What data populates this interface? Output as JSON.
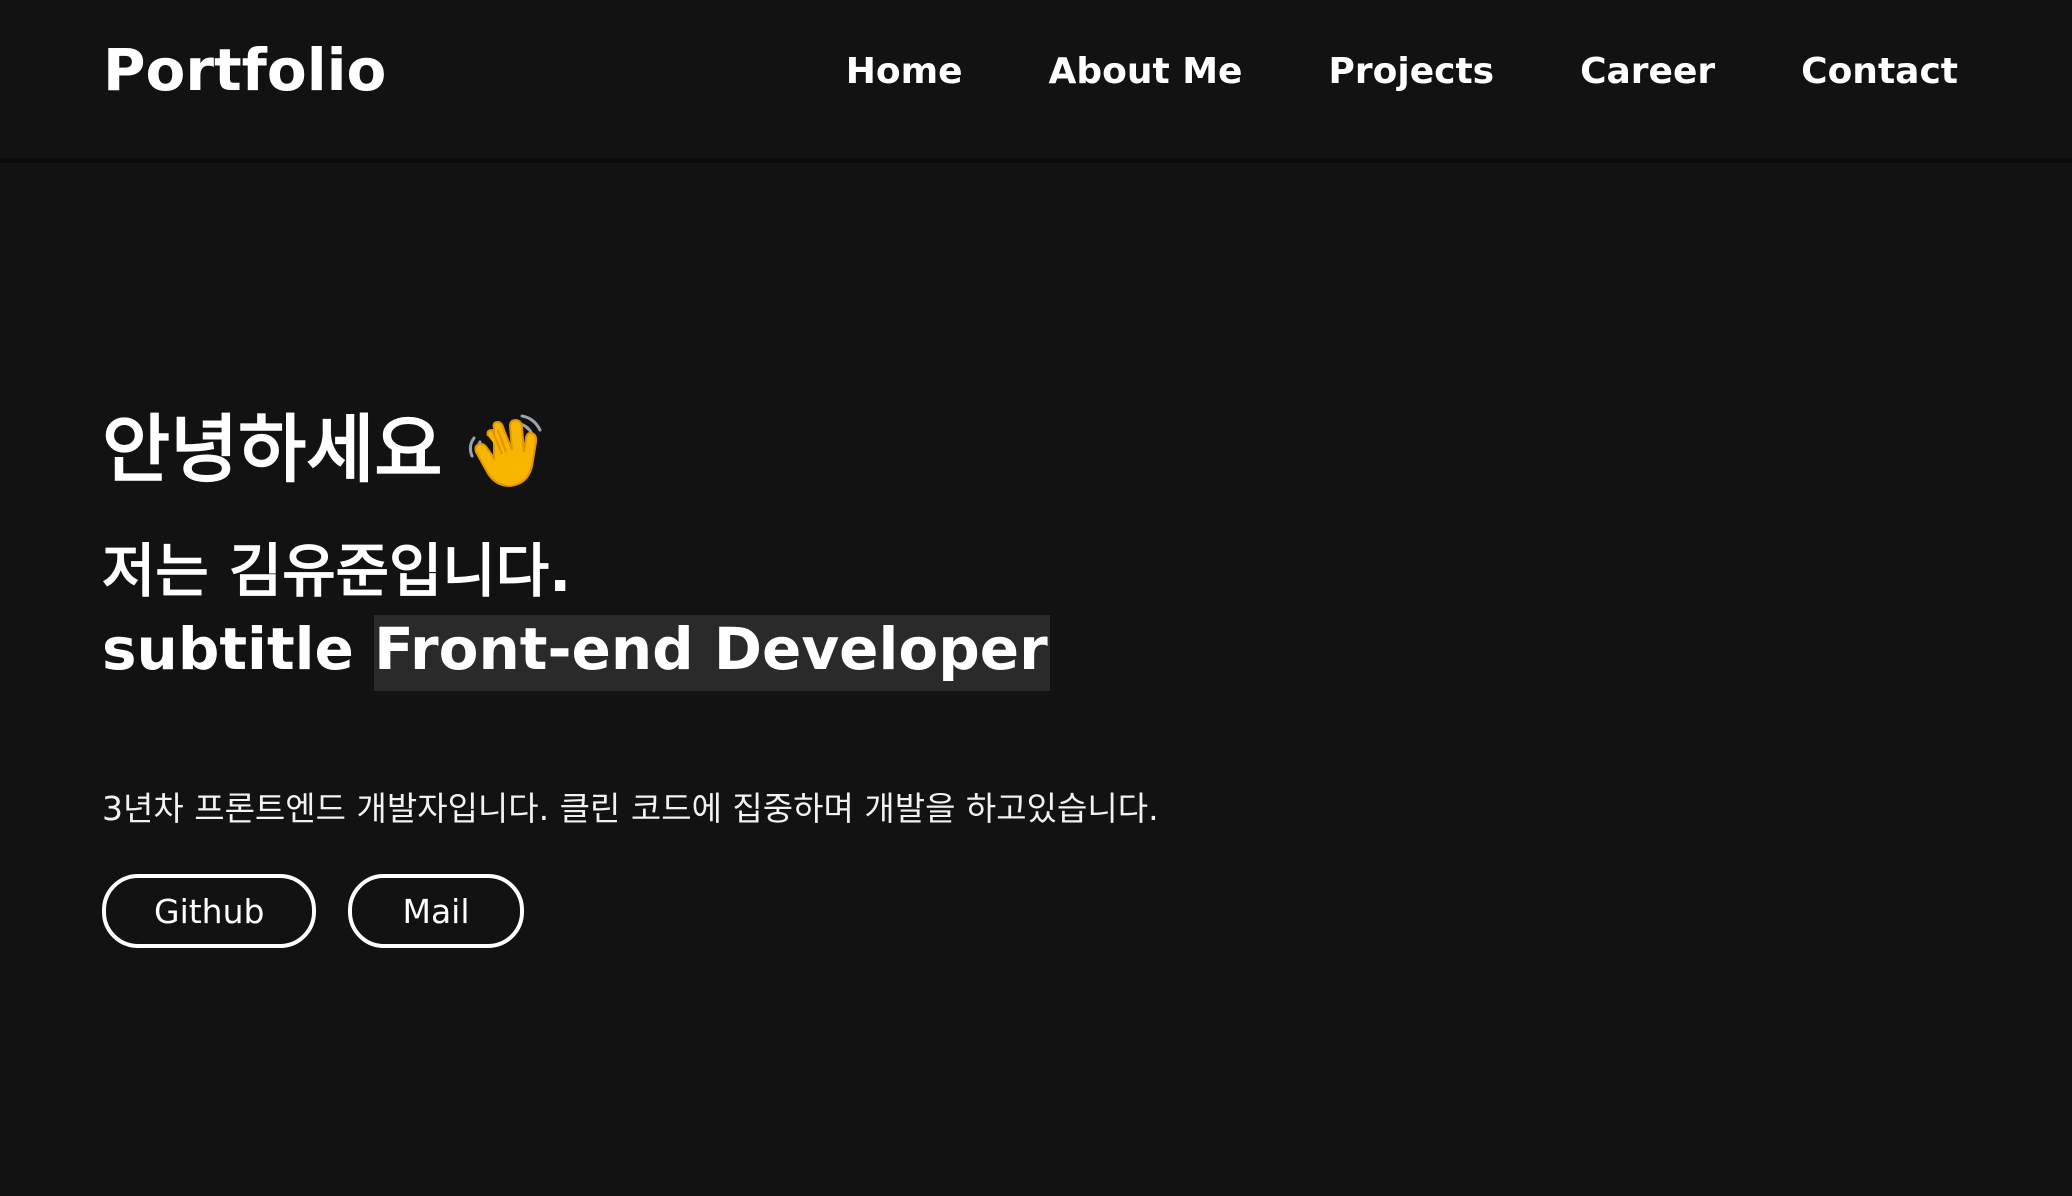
{
  "header": {
    "logo": "Portfolio",
    "nav": [
      "Home",
      "About Me",
      "Projects",
      "Career",
      "Contact"
    ]
  },
  "hero": {
    "greeting": "안녕하세요",
    "greeting_emoji": "waving-hand-icon",
    "intro": "저는 김유준입니다.",
    "subtitle_prefix": "subtitle",
    "role": "Front-end Developer",
    "description": "3년차 프론트엔드 개발자입니다. 클린 코드에 집중하며 개발을 하고있습니다.",
    "buttons": [
      "Github",
      "Mail"
    ]
  },
  "colors": {
    "background": "#121212",
    "text": "#ffffff",
    "highlight": "#2a2a2a",
    "emoji": "#f7b500"
  }
}
